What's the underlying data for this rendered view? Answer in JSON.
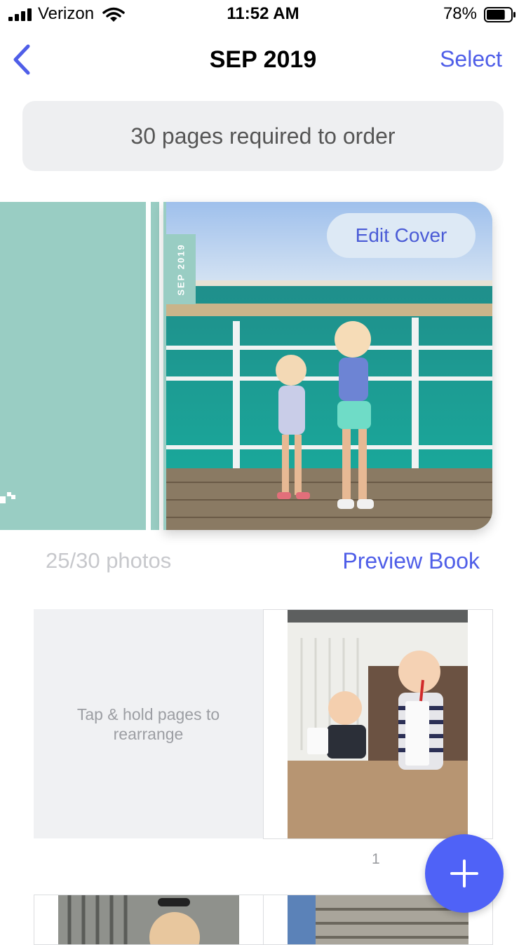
{
  "status_bar": {
    "carrier": "Verizon",
    "time": "11:52 AM",
    "battery_percent": "78%",
    "battery_level": 0.78,
    "icons": [
      "signal-icon",
      "wifi-icon",
      "battery-icon"
    ]
  },
  "nav": {
    "title": "SEP 2019",
    "select_label": "Select",
    "back_icon": "chevron-left-icon"
  },
  "banner": {
    "text": "30 pages required to order"
  },
  "book": {
    "spine_label": "SEP 2019",
    "edit_cover_label": "Edit Cover",
    "photo_count": "25/30 photos",
    "preview_label": "Preview Book"
  },
  "pages": {
    "hint_text": "Tap & hold pages to rearrange",
    "first_page_number": "1"
  },
  "fab": {
    "icon": "plus-icon"
  },
  "colors": {
    "accent": "#4f5ee8",
    "cover_teal": "#99cdc3",
    "banner_bg": "#eeeff1",
    "fab_bg": "#4f62f7"
  }
}
